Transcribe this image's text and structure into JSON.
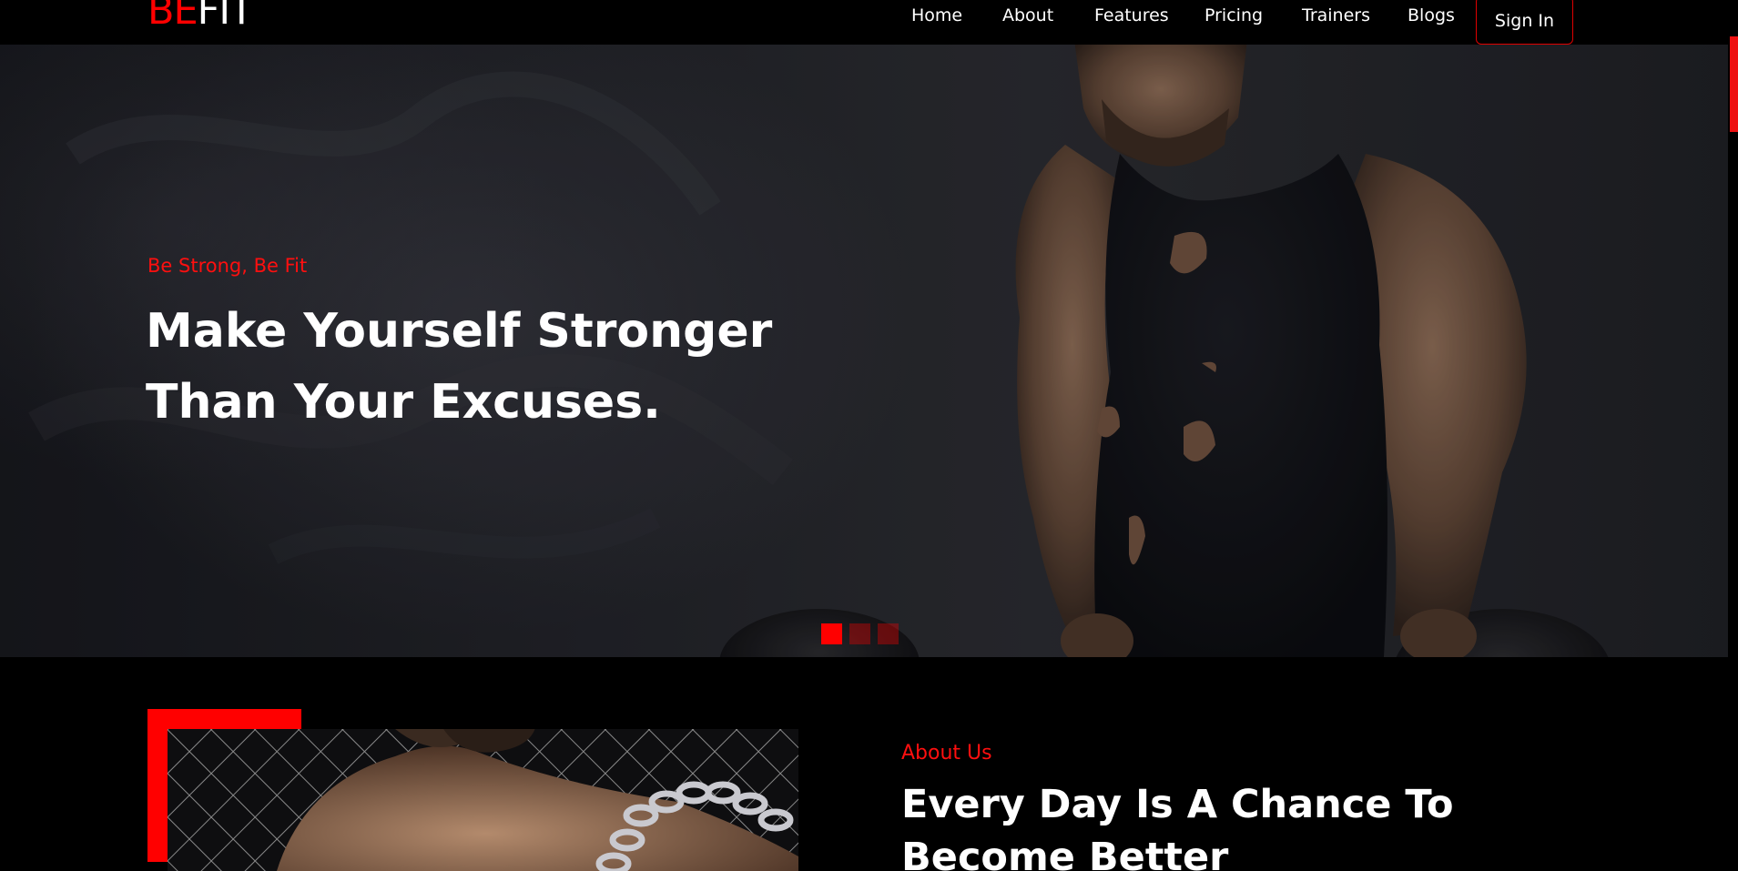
{
  "brand": {
    "part1": "BE",
    "part2": "FIT"
  },
  "nav": {
    "items": [
      {
        "label": "Home"
      },
      {
        "label": "About"
      },
      {
        "label": "Features"
      },
      {
        "label": "Pricing"
      },
      {
        "label": "Trainers"
      },
      {
        "label": "Blogs"
      }
    ],
    "signin_label": "Sign In"
  },
  "hero": {
    "tagline": "Be Strong, Be Fit",
    "title": "Make Yourself Stronger Than Your Excuses.",
    "slides_total": 3,
    "active_slide": 1
  },
  "about": {
    "kicker": "About Us",
    "title": "Every Day Is A Chance To Become Better"
  },
  "colors": {
    "accent": "#ff0000",
    "background": "#000000",
    "text": "#ffffff"
  }
}
